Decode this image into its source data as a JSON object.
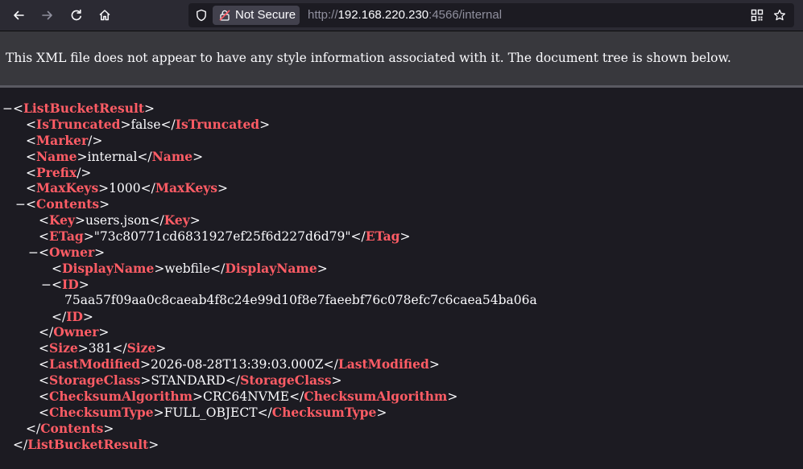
{
  "browser": {
    "security_label": "Not Secure",
    "url_scheme": "http://",
    "url_host": "192.168.220.230",
    "url_rest": ":4566/internal"
  },
  "banner": {
    "message": "This XML file does not appear to have any style information associated with it. The document tree is shown below."
  },
  "xml": {
    "root": "ListBucketResult",
    "is_truncated": {
      "tag": "IsTruncated",
      "value": "false"
    },
    "marker_tag": "Marker",
    "name": {
      "tag": "Name",
      "value": "internal"
    },
    "prefix_tag": "Prefix",
    "max_keys": {
      "tag": "MaxKeys",
      "value": "1000"
    },
    "contents": {
      "tag": "Contents",
      "key": {
        "tag": "Key",
        "value": "users.json"
      },
      "etag": {
        "tag": "ETag",
        "value": "\"73c80771cd6831927ef25f6d227d6d79\""
      },
      "owner": {
        "tag": "Owner",
        "display_name": {
          "tag": "DisplayName",
          "value": "webfile"
        },
        "id": {
          "tag": "ID",
          "value": "75aa57f09aa0c8caeab4f8c24e99d10f8e7faeebf76c078efc7c6caea54ba06a"
        }
      },
      "size": {
        "tag": "Size",
        "value": "381"
      },
      "last_modified": {
        "tag": "LastModified",
        "value": "2026-08-28T13:39:03.000Z"
      },
      "storage_class": {
        "tag": "StorageClass",
        "value": "STANDARD"
      },
      "checksum_algorithm": {
        "tag": "ChecksumAlgorithm",
        "value": "CRC64NVME"
      },
      "checksum_type": {
        "tag": "ChecksumType",
        "value": "FULL_OBJECT"
      }
    },
    "toggle_glyph": "−"
  },
  "colors": {
    "tag": "#ff5c65",
    "text": "#fbfbfe",
    "background": "#1c1b22"
  }
}
